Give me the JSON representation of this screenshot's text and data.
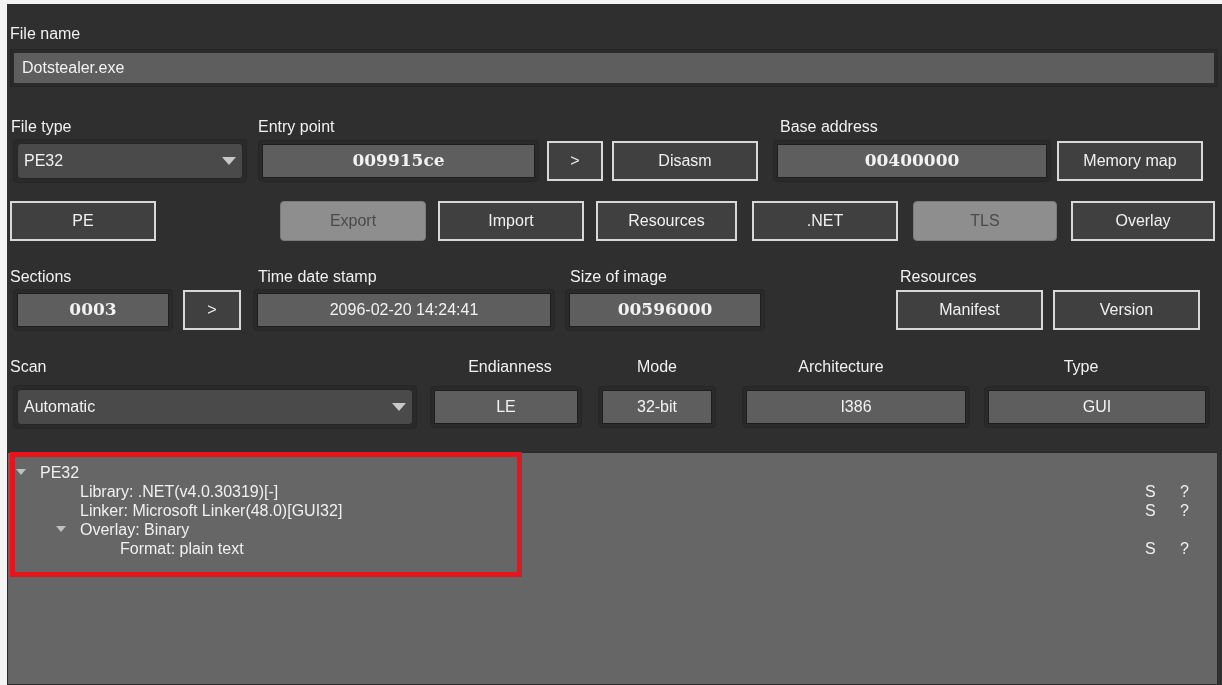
{
  "file_name": {
    "label": "File name",
    "value": "Dotstealer.exe"
  },
  "file_type": {
    "label": "File type",
    "value": "PE32"
  },
  "entry_point": {
    "label": "Entry point",
    "value": "009915ce",
    "go": ">",
    "disasm": "Disasm"
  },
  "base_address": {
    "label": "Base address",
    "value": "00400000",
    "memory_map": "Memory map"
  },
  "info_buttons": [
    {
      "label": "PE",
      "disabled": false
    },
    {
      "label": "Export",
      "disabled": true
    },
    {
      "label": "Import",
      "disabled": false
    },
    {
      "label": "Resources",
      "disabled": false
    },
    {
      "label": ".NET",
      "disabled": false
    },
    {
      "label": "TLS",
      "disabled": true
    },
    {
      "label": "Overlay",
      "disabled": false
    }
  ],
  "sections": {
    "label": "Sections",
    "value": "0003",
    "go": ">"
  },
  "time_date_stamp": {
    "label": "Time date stamp",
    "value": "2096-02-20 14:24:41"
  },
  "size_of_image": {
    "label": "Size of image",
    "value": "00596000"
  },
  "resources": {
    "label": "Resources",
    "buttons": [
      "Manifest",
      "Version"
    ]
  },
  "scan": {
    "label": "Scan",
    "value": "Automatic"
  },
  "endianness": {
    "label": "Endianness",
    "value": "LE"
  },
  "mode": {
    "label": "Mode",
    "value": "32-bit"
  },
  "architecture": {
    "label": "Architecture",
    "value": "I386"
  },
  "type": {
    "label": "Type",
    "value": "GUI"
  },
  "tree": [
    {
      "text": "PE32",
      "expanded": true,
      "children": [
        {
          "text": "Library: .NET(v4.0.30319)[-]",
          "flags": [
            "S",
            "?"
          ]
        },
        {
          "text": "Linker: Microsoft Linker(48.0)[GUI32]",
          "flags": [
            "S",
            "?"
          ]
        },
        {
          "text": "Overlay: Binary",
          "expanded": true,
          "children": [
            {
              "text": "Format: plain text",
              "flags": [
                "S",
                "?"
              ]
            }
          ]
        }
      ]
    }
  ]
}
